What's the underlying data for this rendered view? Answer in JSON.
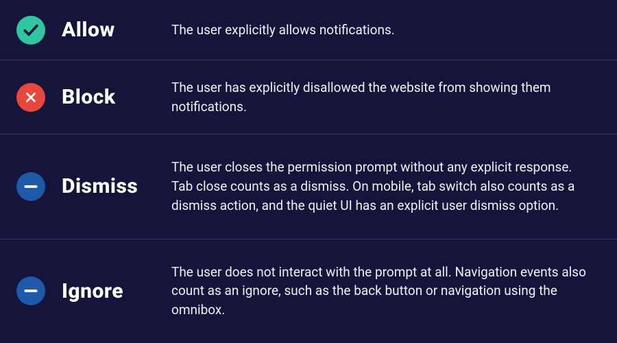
{
  "rows": [
    {
      "icon": "check",
      "icon_bg": "#2fc6a0",
      "label": "Allow",
      "desc": "The user explicitly allows notifications."
    },
    {
      "icon": "cross",
      "icon_bg": "#e8483b",
      "label": "Block",
      "desc": "The user has explicitly disallowed the website from showing them notifications."
    },
    {
      "icon": "minus",
      "icon_bg": "#1f5aa8",
      "label": "Dismiss",
      "desc": "The user closes the permission prompt without any explicit response. Tab close counts as a dismiss. On mobile, tab switch also counts as a dismiss action, and the quiet UI has an explicit user dismiss option."
    },
    {
      "icon": "minus",
      "icon_bg": "#1f5aa8",
      "label": "Ignore",
      "desc": "The user does not interact with the prompt at all. Navigation events also count as an ignore, such as the back button or navigation using the omnibox."
    }
  ]
}
